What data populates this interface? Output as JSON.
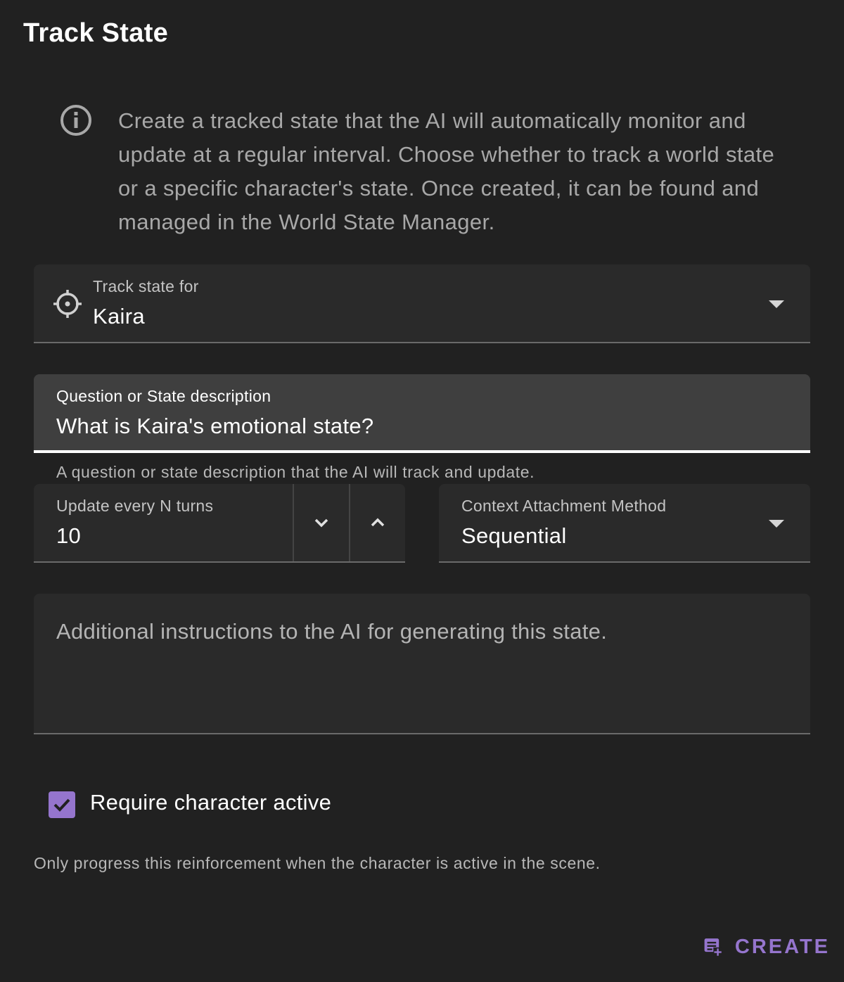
{
  "dialog": {
    "title": "Track State",
    "info_text": "Create a tracked state that the AI will automatically monitor and update at a regular interval. Choose whether to track a world state or a specific character's state. Once created, it can be found and managed in the World State Manager."
  },
  "track_for": {
    "label": "Track state for",
    "value": "Kaira",
    "icon": "crosshairs-icon"
  },
  "question": {
    "label": "Question or State description",
    "value": "What is Kaira's emotional state?",
    "helper": "A question or state description that the AI will track and update."
  },
  "interval": {
    "label": "Update every N turns",
    "value": "10"
  },
  "context_method": {
    "label": "Context Attachment Method",
    "value": "Sequential"
  },
  "instructions": {
    "placeholder": "Additional instructions to the AI for generating this state."
  },
  "require_active": {
    "label": "Require character active",
    "checked": true,
    "helper": "Only progress this reinforcement when the character is active in the scene."
  },
  "actions": {
    "create_label": "CREATE",
    "create_icon": "playlist-plus-icon"
  },
  "colors": {
    "background": "#212121",
    "field_bg": "#2a2a2a",
    "focused_field_bg": "#3f3f3f",
    "accent": "#9575cd"
  }
}
